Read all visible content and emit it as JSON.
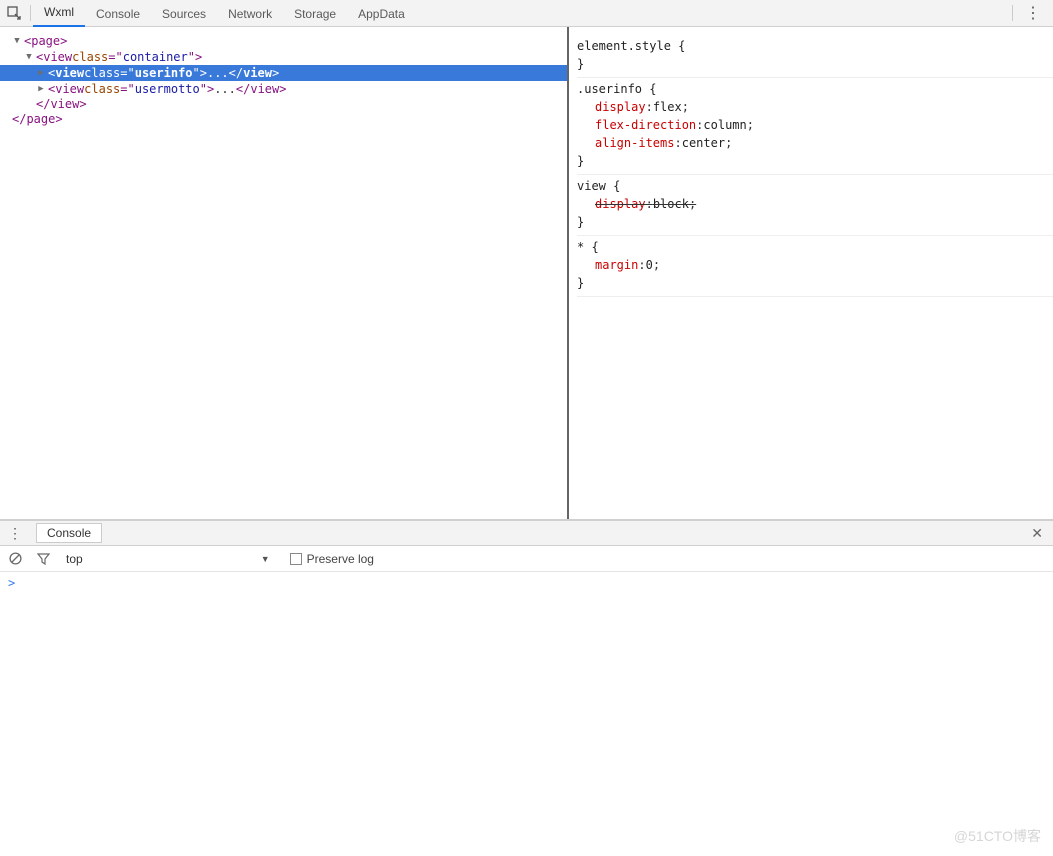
{
  "toolbar": {
    "tabs": [
      "Wxml",
      "Console",
      "Sources",
      "Network",
      "Storage",
      "AppData"
    ],
    "active_tab": 0
  },
  "tree": {
    "page_open": "<page>",
    "container_open": "<view class=\"container\">",
    "userinfo_selected": {
      "tag": "view",
      "attr_name": "class",
      "attr_val": "userinfo"
    },
    "usermotto": {
      "tag": "view",
      "attr_name": "class",
      "attr_val": "usermotto"
    },
    "view_close": "</view>",
    "page_close": "</page>"
  },
  "styles": {
    "blocks": [
      {
        "selector": "element.style",
        "rules": []
      },
      {
        "selector": ".userinfo",
        "rules": [
          {
            "prop": "display",
            "val": "flex"
          },
          {
            "prop": "flex-direction",
            "val": "column"
          },
          {
            "prop": "align-items",
            "val": "center"
          }
        ]
      },
      {
        "selector": "view",
        "rules": [
          {
            "prop": "display",
            "val": "block",
            "strike": true
          }
        ]
      },
      {
        "selector": "*",
        "rules": [
          {
            "prop": "margin",
            "val": "0"
          }
        ]
      }
    ]
  },
  "console": {
    "title": "Console",
    "context": "top",
    "preserve_label": "Preserve log",
    "prompt": ">"
  },
  "watermark": "@51CTO博客"
}
